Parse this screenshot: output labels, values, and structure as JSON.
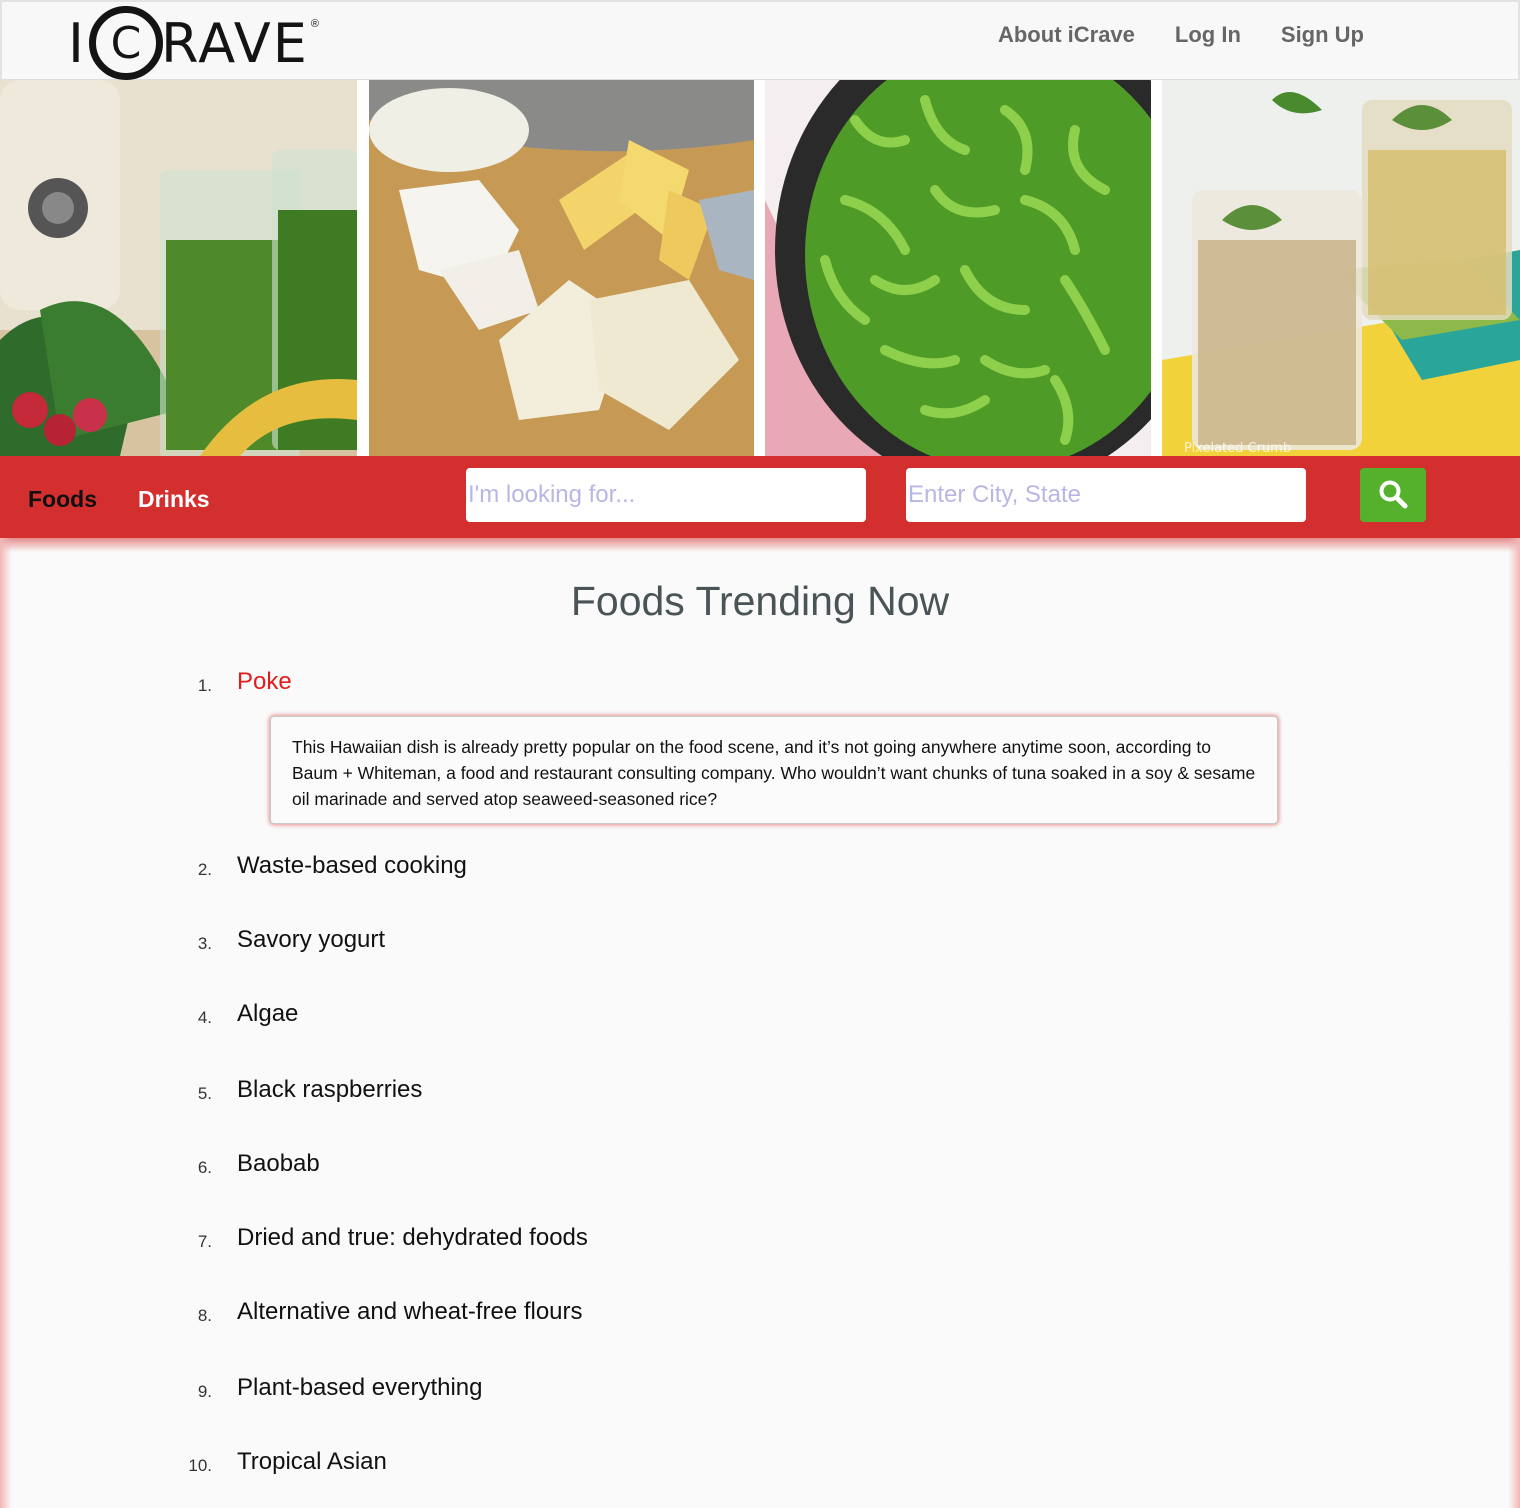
{
  "header": {
    "logo": "ICRAVE",
    "logo_mark": "®",
    "nav": [
      "About iCrave",
      "Log In",
      "Sign Up"
    ]
  },
  "hero": {
    "images": [
      "green-smoothie-photo",
      "cheese-board-photo",
      "edamame-pan-photo",
      "mint-iced-drink-photo"
    ],
    "watermark": "Pixelated Crumb"
  },
  "searchbar": {
    "categories": [
      "Foods",
      "Drinks"
    ],
    "what_placeholder": "I'm looking for...",
    "where_placeholder": "Enter City, State",
    "button_icon": "search-icon"
  },
  "main": {
    "title": "Foods Trending Now",
    "items": [
      {
        "num": "1.",
        "label": "Poke",
        "expanded": true,
        "description": "This Hawaiian dish is already pretty popular on the food scene, and it’s not going anywhere anytime soon, according to Baum + Whiteman, a food and restaurant consulting company. Who wouldn’t want chunks of tuna soaked in a soy & sesame oil marinade and served atop seaweed-seasoned rice?"
      },
      {
        "num": "2.",
        "label": "Waste-based cooking"
      },
      {
        "num": "3.",
        "label": "Savory yogurt"
      },
      {
        "num": "4.",
        "label": "Algae"
      },
      {
        "num": "5.",
        "label": "Black raspberries"
      },
      {
        "num": "6.",
        "label": "Baobab"
      },
      {
        "num": "7.",
        "label": "Dried and true: dehydrated foods"
      },
      {
        "num": "8.",
        "label": "Alternative and wheat-free flours"
      },
      {
        "num": "9.",
        "label": "Plant-based everything"
      },
      {
        "num": "10.",
        "label": "Tropical Asian"
      }
    ]
  },
  "colors": {
    "brand_red": "#d42f2f",
    "active_red": "#e21b1b",
    "search_green": "#55b12b"
  }
}
